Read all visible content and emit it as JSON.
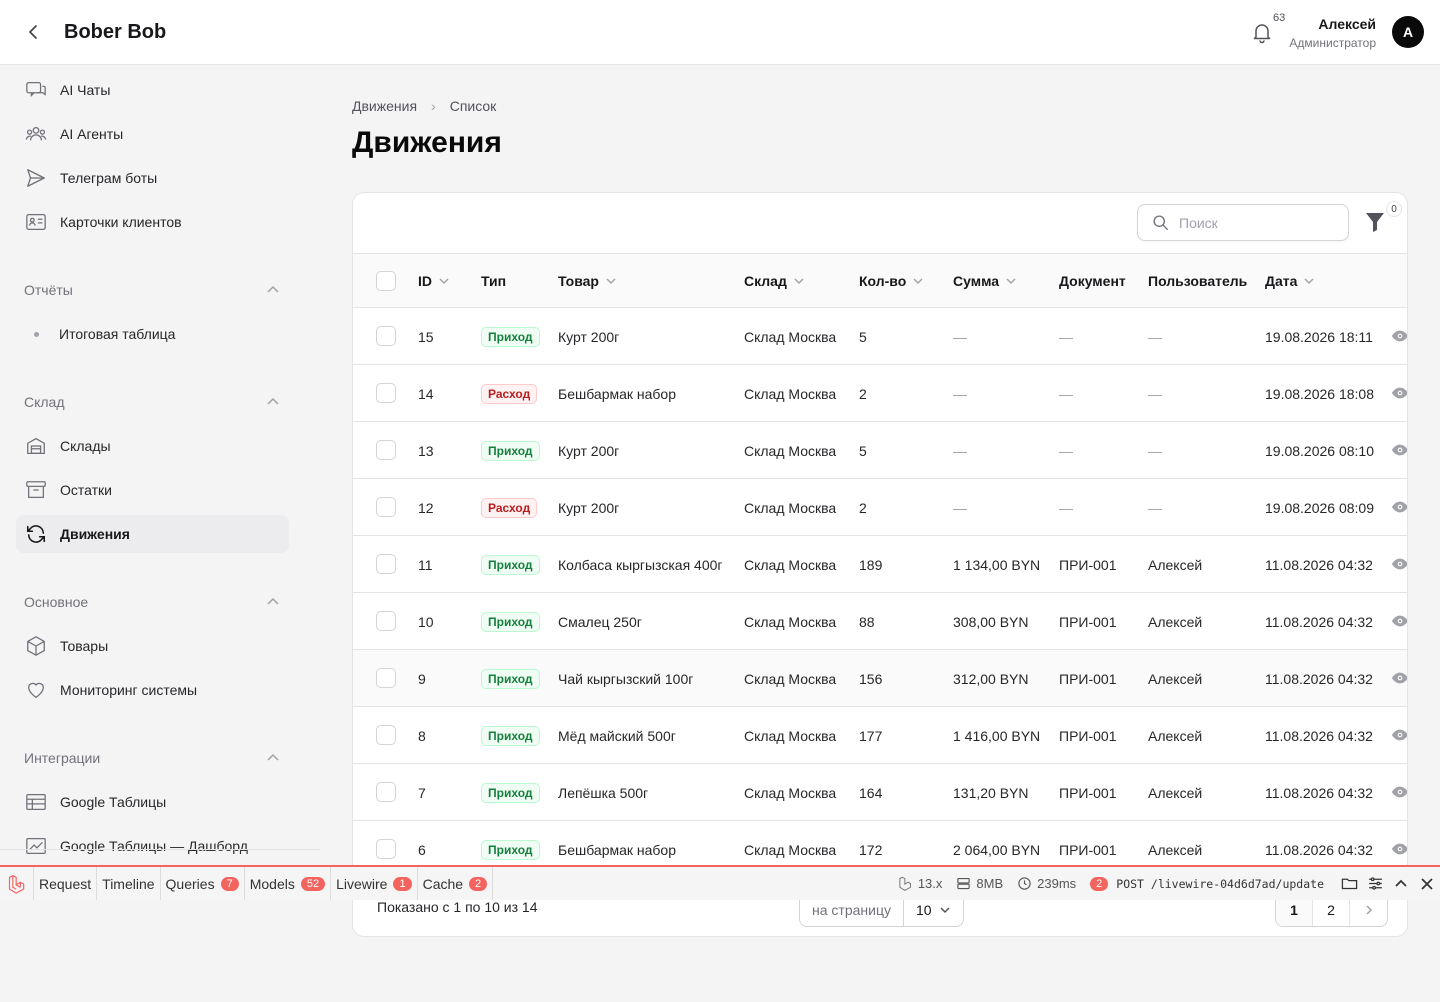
{
  "header": {
    "app_title": "Bober Bob",
    "notifications_count": "63",
    "user_name": "Алексей",
    "user_role": "Администратор",
    "avatar_letter": "А"
  },
  "sidebar": {
    "top_items": [
      {
        "label": "AI Чаты",
        "icon": "chat-icon"
      },
      {
        "label": "AI Агенты",
        "icon": "users-icon"
      },
      {
        "label": "Телеграм боты",
        "icon": "send-icon"
      },
      {
        "label": "Карточки клиентов",
        "icon": "id-card-icon"
      }
    ],
    "groups": [
      {
        "label": "Отчёты",
        "items": [
          {
            "label": "Итоговая таблица"
          }
        ]
      },
      {
        "label": "Склад",
        "items": [
          {
            "label": "Склады"
          },
          {
            "label": "Остатки"
          },
          {
            "label": "Движения",
            "active": true
          }
        ]
      },
      {
        "label": "Основное",
        "items": [
          {
            "label": "Товары"
          },
          {
            "label": "Мониторинг системы"
          }
        ]
      },
      {
        "label": "Интеграции",
        "items": [
          {
            "label": "Google Таблицы"
          },
          {
            "label": "Google Таблицы — Дашборд"
          }
        ]
      }
    ]
  },
  "breadcrumb": [
    "Движения",
    "Список"
  ],
  "page_title": "Движения",
  "table": {
    "search_placeholder": "Поиск",
    "filter_count": "0",
    "columns": [
      "ID",
      "Тип",
      "Товар",
      "Склад",
      "Кол-во",
      "Сумма",
      "Документ",
      "Пользователь",
      "Дата"
    ],
    "rows": [
      {
        "id": "15",
        "type": "Приход",
        "kind": "in",
        "product": "Курт 200г",
        "warehouse": "Склад Москва",
        "qty": "5",
        "sum": "—",
        "doc": "—",
        "user": "—",
        "date": "19.08.2026 18:11"
      },
      {
        "id": "14",
        "type": "Расход",
        "kind": "out",
        "product": "Бешбармак набор",
        "warehouse": "Склад Москва",
        "qty": "2",
        "sum": "—",
        "doc": "—",
        "user": "—",
        "date": "19.08.2026 18:08"
      },
      {
        "id": "13",
        "type": "Приход",
        "kind": "in",
        "product": "Курт 200г",
        "warehouse": "Склад Москва",
        "qty": "5",
        "sum": "—",
        "doc": "—",
        "user": "—",
        "date": "19.08.2026 08:10"
      },
      {
        "id": "12",
        "type": "Расход",
        "kind": "out",
        "product": "Курт 200г",
        "warehouse": "Склад Москва",
        "qty": "2",
        "sum": "—",
        "doc": "—",
        "user": "—",
        "date": "19.08.2026 08:09"
      },
      {
        "id": "11",
        "type": "Приход",
        "kind": "in",
        "product": "Колбаса кыргызская 400г",
        "warehouse": "Склад Москва",
        "qty": "189",
        "sum": "1 134,00 BYN",
        "doc": "ПРИ-001",
        "user": "Алексей",
        "date": "11.08.2026 04:32"
      },
      {
        "id": "10",
        "type": "Приход",
        "kind": "in",
        "product": "Смалец 250г",
        "warehouse": "Склад Москва",
        "qty": "88",
        "sum": "308,00 BYN",
        "doc": "ПРИ-001",
        "user": "Алексей",
        "date": "11.08.2026 04:32"
      },
      {
        "id": "9",
        "type": "Приход",
        "kind": "in",
        "product": "Чай кыргызский 100г",
        "warehouse": "Склад Москва",
        "qty": "156",
        "sum": "312,00 BYN",
        "doc": "ПРИ-001",
        "user": "Алексей",
        "date": "11.08.2026 04:32"
      },
      {
        "id": "8",
        "type": "Приход",
        "kind": "in",
        "product": "Мёд майский 500г",
        "warehouse": "Склад Москва",
        "qty": "177",
        "sum": "1 416,00 BYN",
        "doc": "ПРИ-001",
        "user": "Алексей",
        "date": "11.08.2026 04:32"
      },
      {
        "id": "7",
        "type": "Приход",
        "kind": "in",
        "product": "Лепёшка 500г",
        "warehouse": "Склад Москва",
        "qty": "164",
        "sum": "131,20 BYN",
        "doc": "ПРИ-001",
        "user": "Алексей",
        "date": "11.08.2026 04:32"
      },
      {
        "id": "6",
        "type": "Приход",
        "kind": "in",
        "product": "Бешбармак набор",
        "warehouse": "Склад Москва",
        "qty": "172",
        "sum": "2 064,00 BYN",
        "doc": "ПРИ-001",
        "user": "Алексей",
        "date": "11.08.2026 04:32"
      }
    ],
    "footer_info": "Показано с 1 по 10 из 14",
    "per_page_label": "на страницу",
    "per_page_value": "10",
    "pages": [
      "1",
      "2"
    ]
  },
  "debugbar": {
    "tabs": [
      {
        "label": "Request"
      },
      {
        "label": "Timeline"
      },
      {
        "label": "Queries",
        "badge": "7"
      },
      {
        "label": "Models",
        "badge": "52"
      },
      {
        "label": "Livewire",
        "badge": "1"
      },
      {
        "label": "Cache",
        "badge": "2"
      }
    ],
    "version": "13.x",
    "memory": "8MB",
    "time": "239ms",
    "request_count": "2",
    "request": "POST /livewire-04d6d7ad/update",
    "accent_color": "#f4645f"
  }
}
